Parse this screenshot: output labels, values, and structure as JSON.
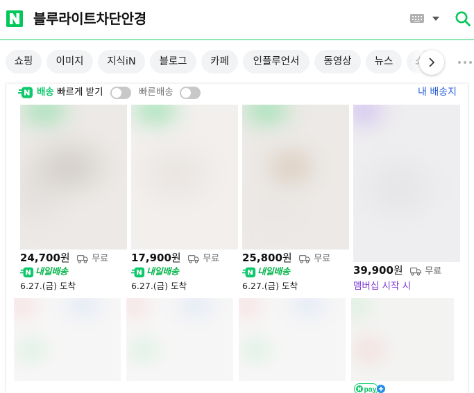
{
  "header": {
    "logo_label": "N",
    "query": "블루라이트차단안경",
    "icons": [
      "naver-logo-icon",
      "keyboard-icon",
      "caret-down-icon",
      "search-icon"
    ],
    "accent_color": "#03c75a"
  },
  "tabs": {
    "items": [
      {
        "label": "쇼핑"
      },
      {
        "label": "이미지"
      },
      {
        "label": "지식iN"
      },
      {
        "label": "블로그"
      },
      {
        "label": "카페"
      },
      {
        "label": "인플루언서"
      },
      {
        "label": "동영상"
      },
      {
        "label": "뉴스"
      },
      {
        "label": "쇼"
      }
    ],
    "next_icon": "chevron-right-icon",
    "more_icon": "more-dots-icon"
  },
  "filters": {
    "fast_prefix": "배송",
    "fast_rest": " 빠르게 받기",
    "fast_toggle_on": false,
    "fast2_label": "빠른배송",
    "fast2_toggle_on": false,
    "my_address": "내 배송지"
  },
  "products": [
    {
      "price": "24,700",
      "unit": "원",
      "shipping": "무료",
      "delivery_tag": "내일배송",
      "arrival": "6.27.(금) 도착",
      "colors": [
        "#8fe0a8",
        "#ece9e6",
        "#cfcac5",
        "#e3dfdc"
      ]
    },
    {
      "price": "17,900",
      "unit": "원",
      "shipping": "무료",
      "delivery_tag": "내일배송",
      "arrival": "6.27.(금) 도착",
      "colors": [
        "#8fe0a8",
        "#f2efed",
        "#e8e3df",
        "#efece9"
      ]
    },
    {
      "price": "25,800",
      "unit": "원",
      "shipping": "무료",
      "delivery_tag": "내일배송",
      "arrival": "6.27.(금) 도착",
      "colors": [
        "#8fe0a8",
        "#ece9e6",
        "#d8c7b5",
        "#e9e6e3"
      ]
    },
    {
      "price": "39,900",
      "unit": "원",
      "shipping": "무료",
      "member_text": "멤버십 시작 시",
      "colors": [
        "#c9b8f2",
        "#eeedef",
        "#e4e3e6",
        "#eceaf0"
      ]
    }
  ],
  "products_row2": [
    {
      "colors": [
        "#f6d6d6",
        "#d8e4f6",
        "#c6ecd3"
      ]
    },
    {
      "colors": [
        "#f6d6d6",
        "#d8e4f6",
        "#c6ecd3"
      ]
    },
    {
      "colors": [
        "#f6d6d6",
        "#d8e4f6",
        "#c6ecd3"
      ]
    },
    {
      "colors": [
        "#cfeccf",
        "#eeeeee",
        "#f3d3d3"
      ],
      "badge": "npay"
    }
  ],
  "npay_badge": {
    "label": "pay",
    "icon": "npay-plus-icon"
  }
}
